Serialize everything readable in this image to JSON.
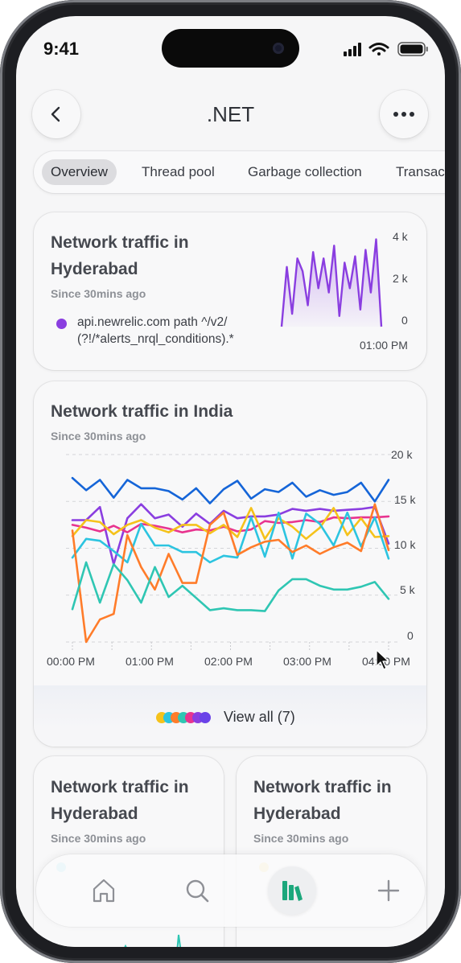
{
  "status_bar": {
    "time": "9:41"
  },
  "header": {
    "title": ".NET",
    "back_icon": "chevron-left-icon",
    "more_icon": "ellipsis-icon"
  },
  "tabs": [
    {
      "label": "Overview",
      "active": true
    },
    {
      "label": "Thread pool",
      "active": false
    },
    {
      "label": "Garbage collection",
      "active": false
    },
    {
      "label": "Transac",
      "active": false
    }
  ],
  "card_hyderabad": {
    "title_line1": "Network traffic in",
    "title_line2": "Hyderabad",
    "subtitle": "Since 30mins ago",
    "legend_line1": "api.newrelic.com path ^/v2/",
    "legend_line2": "(?!/*alerts_nrql_conditions).*",
    "y_ticks": [
      "4 k",
      "2 k",
      "0"
    ],
    "x_tick": "01:00 PM",
    "accent_color": "#8a3ee0"
  },
  "card_india": {
    "title": "Network traffic in India",
    "subtitle": "Since 30mins ago",
    "y_ticks": [
      "20 k",
      "15 k",
      "10 k",
      "5 k",
      "0"
    ],
    "x_ticks": [
      "00:00 PM",
      "01:00 PM",
      "02:00 PM",
      "03:00 PM",
      "04:00 PM"
    ],
    "view_all_label": "View all (7)",
    "swatch_colors": [
      "#f5c21b",
      "#2cc4e0",
      "#ff7c2a",
      "#2fc6b3",
      "#e8348f",
      "#8a3ee0",
      "#6a42e8"
    ]
  },
  "card_small_left": {
    "title_line1": "Network traffic in",
    "title_line2": "Hyderabad",
    "subtitle": "Since 30mins ago"
  },
  "card_small_right": {
    "title_line1": "Network traffic in",
    "title_line2": "Hyderabad",
    "subtitle": "Since 30mins ago"
  },
  "bottom_nav": [
    {
      "icon": "home-icon",
      "active": false
    },
    {
      "icon": "search-icon",
      "active": false
    },
    {
      "icon": "library-icon",
      "active": true
    },
    {
      "icon": "plus-icon",
      "active": false
    }
  ],
  "chart_data": [
    {
      "type": "area",
      "x_label_shown": "01:00 PM",
      "ylim": [
        0,
        4000
      ],
      "y_ticks": [
        "0",
        "2 k",
        "4 k"
      ],
      "series": [
        {
          "name": "api.newrelic.com path ^/v2/(?!/*alerts_nrql_conditions).*",
          "values": [
            0,
            2800,
            600,
            3200,
            2600,
            1000,
            3500,
            1800,
            3200,
            1600,
            3800,
            500,
            3000,
            1800,
            3300,
            800,
            3600,
            1600,
            4100,
            0
          ]
        }
      ],
      "color": "#8a3ee0",
      "grid": false
    },
    {
      "type": "line",
      "title": "Network traffic in India",
      "x": [
        "00:00 PM",
        "",
        "01:00 PM",
        "",
        "02:00 PM",
        "",
        "03:00 PM",
        "",
        "04:00 PM"
      ],
      "ylim": [
        0,
        20000
      ],
      "y_ticks": [
        "0",
        "5 k",
        "10 k",
        "15 k",
        "20 k"
      ],
      "grid": true,
      "series": [
        {
          "color": "#1565d8",
          "values": [
            17500,
            16200,
            17300,
            15400,
            17300,
            16400,
            16400,
            16100,
            15200,
            16400,
            14800,
            16300,
            17200,
            15300,
            16300,
            16000,
            17000,
            15500,
            16200,
            15700,
            16000,
            17000,
            15000,
            17300
          ]
        },
        {
          "color": "#8a3ee0",
          "values": [
            13000,
            13000,
            14400,
            8300,
            13200,
            14700,
            13200,
            13600,
            12300,
            13700,
            12600,
            14000,
            13200,
            13400,
            13400,
            13600,
            14200,
            14000,
            14200,
            14000,
            14100,
            14200,
            14400,
            10500
          ]
        },
        {
          "color": "#e8348f",
          "values": [
            12500,
            12200,
            11800,
            12400,
            11700,
            12600,
            12400,
            12100,
            11700,
            12000,
            11900,
            12300,
            11800,
            12000,
            12900,
            12700,
            12800,
            13000,
            12800,
            13300,
            13200,
            13300,
            13300,
            13400
          ]
        },
        {
          "color": "#f5c21b",
          "values": [
            11300,
            13000,
            12800,
            11500,
            12500,
            13000,
            12200,
            11700,
            12500,
            12500,
            11600,
            12500,
            11200,
            14300,
            11000,
            13200,
            12300,
            11000,
            12200,
            14300,
            11400,
            13200,
            11200,
            11300
          ]
        },
        {
          "color": "#2cc4e0",
          "values": [
            9000,
            11000,
            10800,
            9700,
            8500,
            12600,
            10300,
            10300,
            9600,
            9600,
            8500,
            9200,
            9000,
            13300,
            9100,
            13800,
            8900,
            13700,
            12600,
            10300,
            13800,
            10200,
            13300,
            8900
          ]
        },
        {
          "color": "#ff7c2a",
          "values": [
            11900,
            0,
            2400,
            3000,
            11400,
            8000,
            5600,
            9400,
            6300,
            6300,
            12500,
            13800,
            9300,
            10100,
            10700,
            10900,
            9600,
            10300,
            9400,
            10100,
            10600,
            9700,
            14700,
            9800
          ]
        },
        {
          "color": "#2fc6b3",
          "values": [
            3500,
            8500,
            4200,
            8300,
            6600,
            4200,
            8000,
            4800,
            6000,
            4700,
            3400,
            3600,
            3400,
            3400,
            3300,
            5500,
            6700,
            6700,
            6000,
            5600,
            5600,
            5900,
            6400,
            4600
          ]
        }
      ]
    }
  ]
}
